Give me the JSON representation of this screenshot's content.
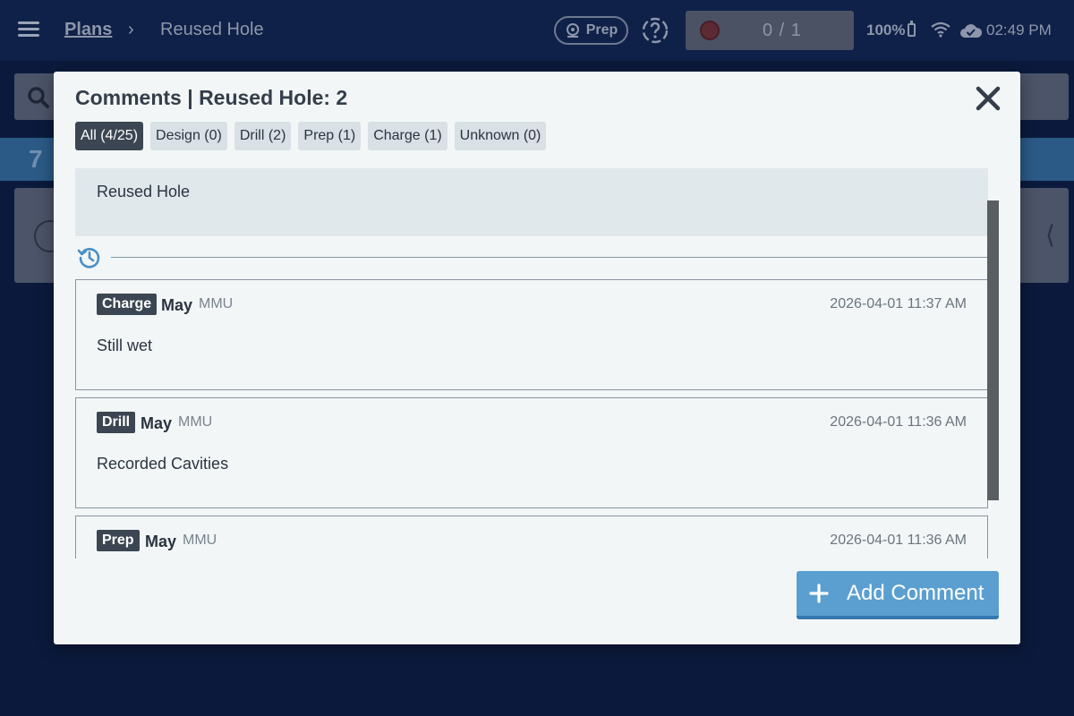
{
  "app": {
    "breadcrumb": {
      "root": "Plans",
      "separator": "›",
      "current": "Reused Hole"
    },
    "mode_chip": "Prep",
    "counter": "0 / 1",
    "status": {
      "battery": "100%",
      "time": "02:49 PM"
    },
    "background_band_number": "7"
  },
  "modal": {
    "title": "Comments | Reused Hole: 2",
    "filters": [
      {
        "label": "All (4/25)",
        "active": true
      },
      {
        "label": "Design (0)",
        "active": false
      },
      {
        "label": "Drill (2)",
        "active": false
      },
      {
        "label": "Prep (1)",
        "active": false
      },
      {
        "label": "Charge (1)",
        "active": false
      },
      {
        "label": "Unknown (0)",
        "active": false
      }
    ],
    "hole_header": "Reused Hole",
    "comments": [
      {
        "tag": "Charge",
        "author": "May",
        "org": "MMU",
        "timestamp": "2026-04-01 11:37 AM",
        "text": "Still wet"
      },
      {
        "tag": "Drill",
        "author": "May",
        "org": "MMU",
        "timestamp": "2026-04-01 11:36 AM",
        "text": "Recorded Cavities"
      },
      {
        "tag": "Prep",
        "author": "May",
        "org": "MMU",
        "timestamp": "2026-04-01 11:36 AM",
        "text": ""
      }
    ],
    "add_button_label": "Add Comment"
  },
  "colors": {
    "backdrop": "#0b1a3c",
    "modal_bg": "#f2f6f7",
    "tag_bg": "#3c4652",
    "accent_button": "#5b9fd0",
    "history_icon": "#4a8fc4"
  }
}
